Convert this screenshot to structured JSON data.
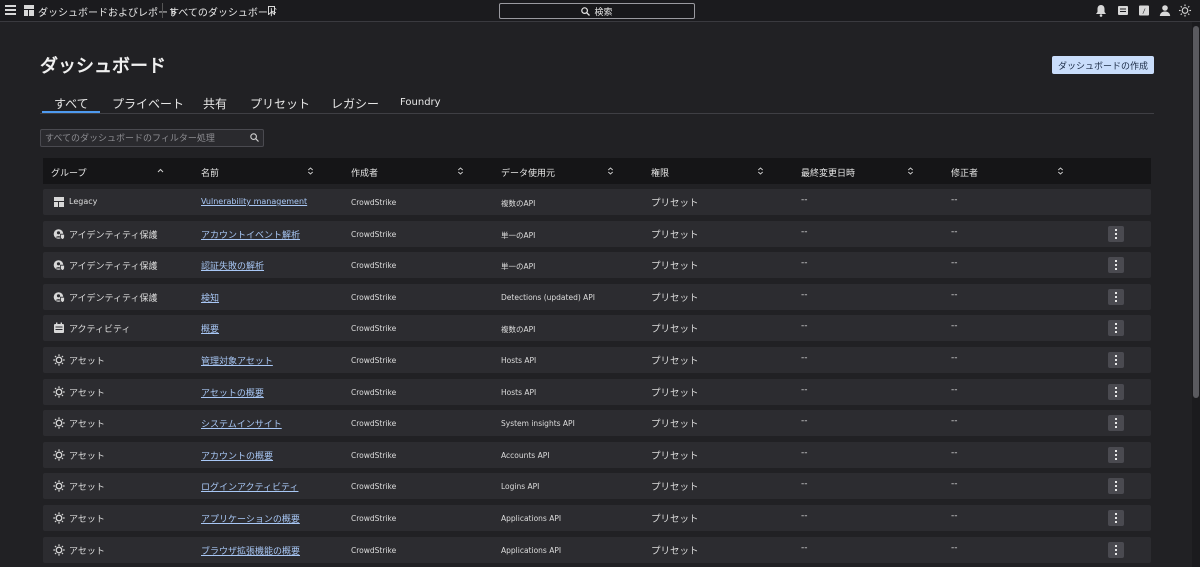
{
  "topbar": {
    "title": "ダッシュボードおよびレポート",
    "subtitle": "すべてのダッシュボード",
    "search_label": "検索"
  },
  "page": {
    "title": "ダッシュボード",
    "create_button": "ダッシュボードの作成"
  },
  "tabs": [
    {
      "label": "すべて",
      "active": true
    },
    {
      "label": "プライベート"
    },
    {
      "label": "共有"
    },
    {
      "label": "プリセット"
    },
    {
      "label": "レガシー"
    },
    {
      "label": "Foundry"
    }
  ],
  "filter": {
    "placeholder": "すべてのダッシュボードのフィルター処理"
  },
  "table": {
    "columns": [
      "グループ",
      "名前",
      "作成者",
      "データ使用元",
      "権限",
      "最終変更日時",
      "修正者"
    ],
    "rows": [
      {
        "group": "Legacy",
        "group_icon": "layout-icon",
        "name": "Vulnerability management",
        "author": "CrowdStrike",
        "api": "複数のAPI",
        "perm": "プリセット",
        "mod": "--",
        "editor": "--",
        "menu": false
      },
      {
        "group": "アイデンティティ保護",
        "group_icon": "identity-shield-icon",
        "name": "アカウントイベント解析",
        "author": "CrowdStrike",
        "api": "単一のAPI",
        "perm": "プリセット",
        "mod": "--",
        "editor": "--",
        "menu": true
      },
      {
        "group": "アイデンティティ保護",
        "group_icon": "identity-shield-icon",
        "name": "認証失敗の解析",
        "author": "CrowdStrike",
        "api": "単一のAPI",
        "perm": "プリセット",
        "mod": "--",
        "editor": "--",
        "menu": true
      },
      {
        "group": "アイデンティティ保護",
        "group_icon": "identity-shield-icon",
        "name": "検知",
        "author": "CrowdStrike",
        "api": "Detections (updated) API",
        "perm": "プリセット",
        "mod": "--",
        "editor": "--",
        "menu": true
      },
      {
        "group": "アクティビティ",
        "group_icon": "activity-icon",
        "name": "概要",
        "author": "CrowdStrike",
        "api": "複数のAPI",
        "perm": "プリセット",
        "mod": "--",
        "editor": "--",
        "menu": true
      },
      {
        "group": "アセット",
        "group_icon": "asset-icon",
        "name": "管理対象アセット",
        "author": "CrowdStrike",
        "api": "Hosts API",
        "perm": "プリセット",
        "mod": "--",
        "editor": "--",
        "menu": true
      },
      {
        "group": "アセット",
        "group_icon": "asset-icon",
        "name": "アセットの概要",
        "author": "CrowdStrike",
        "api": "Hosts API",
        "perm": "プリセット",
        "mod": "--",
        "editor": "--",
        "menu": true
      },
      {
        "group": "アセット",
        "group_icon": "asset-icon",
        "name": "システムインサイト",
        "author": "CrowdStrike",
        "api": "System insights API",
        "perm": "プリセット",
        "mod": "--",
        "editor": "--",
        "menu": true
      },
      {
        "group": "アセット",
        "group_icon": "asset-icon",
        "name": "アカウントの概要",
        "author": "CrowdStrike",
        "api": "Accounts API",
        "perm": "プリセット",
        "mod": "--",
        "editor": "--",
        "menu": true
      },
      {
        "group": "アセット",
        "group_icon": "asset-icon",
        "name": "ログインアクティビティ",
        "author": "CrowdStrike",
        "api": "Logins API",
        "perm": "プリセット",
        "mod": "--",
        "editor": "--",
        "menu": true
      },
      {
        "group": "アセット",
        "group_icon": "asset-icon",
        "name": "アプリケーションの概要",
        "author": "CrowdStrike",
        "api": "Applications API",
        "perm": "プリセット",
        "mod": "--",
        "editor": "--",
        "menu": true
      },
      {
        "group": "アセット",
        "group_icon": "asset-icon",
        "name": "ブラウザ拡張機能の概要",
        "author": "CrowdStrike",
        "api": "Applications API",
        "perm": "プリセット",
        "mod": "--",
        "editor": "--",
        "menu": true
      }
    ]
  },
  "colors": {
    "accent": "#4e9af0",
    "link": "#a8c7f5",
    "button": "#c9ddfb"
  }
}
